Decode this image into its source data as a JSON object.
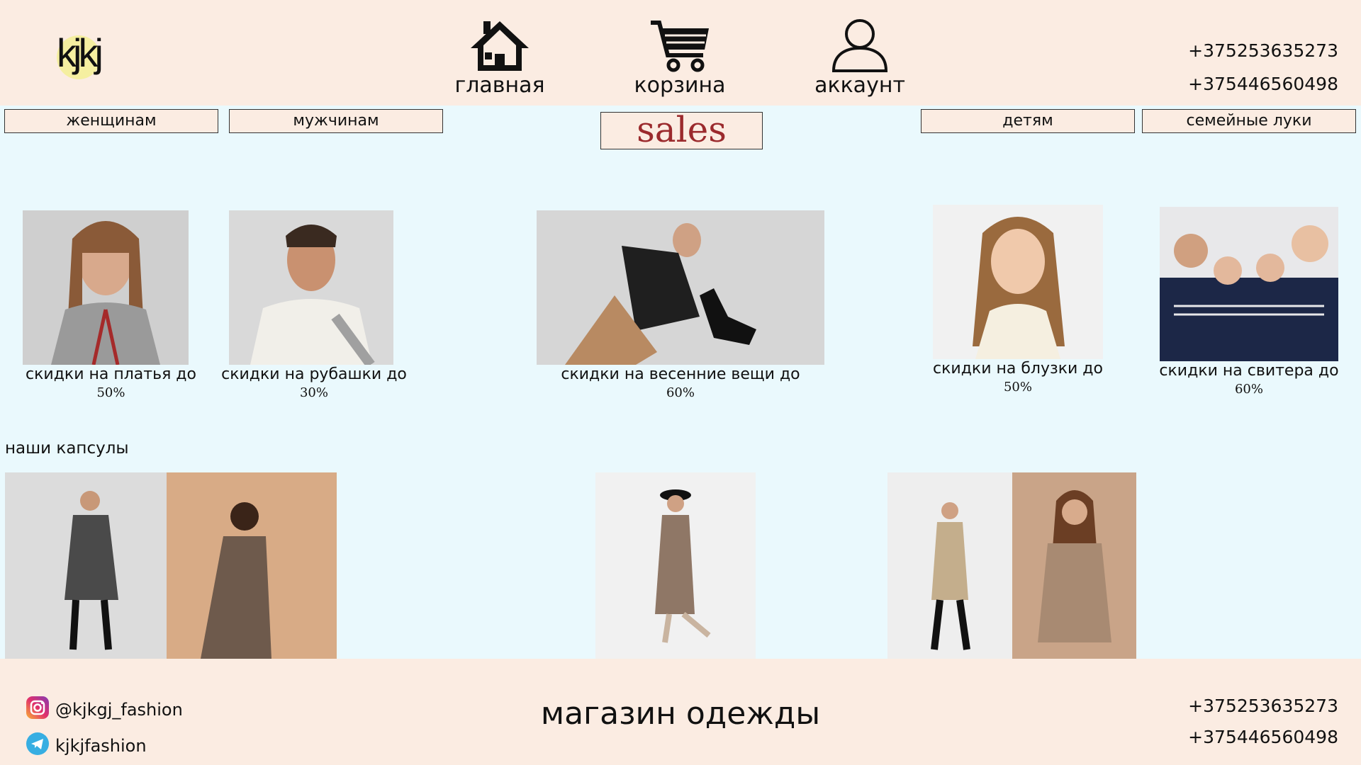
{
  "brand": {
    "logo_text": "kjkj"
  },
  "nav": [
    {
      "label": "главная",
      "icon": "home-icon"
    },
    {
      "label": "корзина",
      "icon": "cart-icon"
    },
    {
      "label": "аккаунт",
      "icon": "user-icon"
    }
  ],
  "contacts": {
    "phone1": "+375253635273",
    "phone2": "+375446560498"
  },
  "categories": {
    "women": "женщинам",
    "men": "мужчинам",
    "sales": "sales",
    "kids": "детям",
    "family": "семейные луки"
  },
  "sales_cards": [
    {
      "caption": "скидки на платья до",
      "percent": "50%"
    },
    {
      "caption": "скидки на рубашки до",
      "percent": "30%"
    },
    {
      "caption": "скидки на весенние вещи до",
      "percent": "60%"
    },
    {
      "caption": "скидки на блузки до",
      "percent": "50%"
    },
    {
      "caption": "скидки на свитера до",
      "percent": "60%"
    }
  ],
  "capsules": {
    "title": "наши капсулы"
  },
  "footer": {
    "instagram": "@kjkgj_fashion",
    "telegram": "kjkjfashion",
    "title": "магазин одежды"
  },
  "colors": {
    "header_bg": "#fbece2",
    "page_bg": "#eaf9fd",
    "sales_text": "#9b2a2d"
  }
}
